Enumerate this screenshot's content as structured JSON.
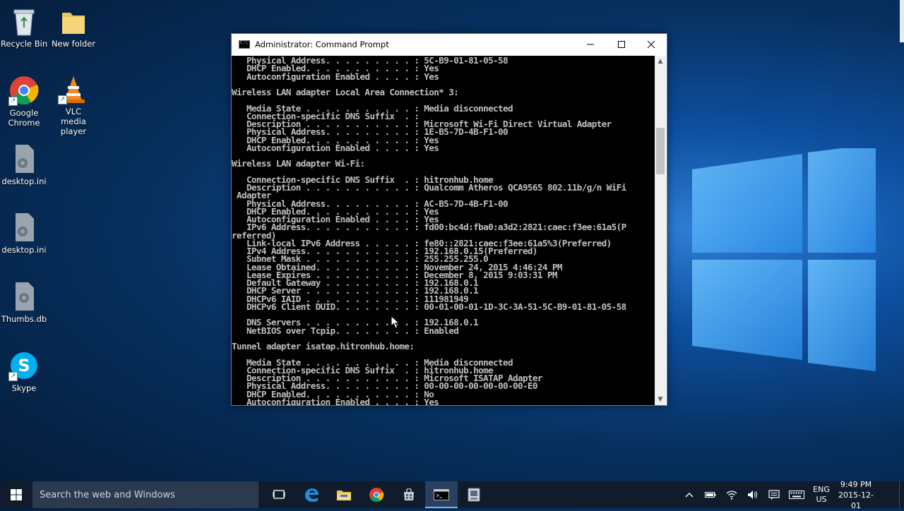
{
  "desktop": {
    "icons": [
      {
        "label": "Recycle Bin",
        "icon": "recycle-bin-icon"
      },
      {
        "label": "New folder",
        "icon": "folder-icon"
      },
      {
        "label": "Google Chrome",
        "icon": "chrome-icon"
      },
      {
        "label": "VLC media player",
        "icon": "vlc-icon"
      },
      {
        "label": "desktop.ini",
        "icon": "settings-file-icon"
      },
      {
        "label": "desktop.ini",
        "icon": "settings-file-icon"
      },
      {
        "label": "Thumbs.db",
        "icon": "settings-file-icon"
      },
      {
        "label": "Skype",
        "icon": "skype-icon"
      }
    ]
  },
  "cmd": {
    "title": "Administrator: Command Prompt",
    "lines": [
      "   Physical Address. . . . . . . . . : 5C-B9-01-81-05-58",
      "   DHCP Enabled. . . . . . . . . . . : Yes",
      "   Autoconfiguration Enabled . . . . : Yes",
      "",
      "Wireless LAN adapter Local Area Connection* 3:",
      "",
      "   Media State . . . . . . . . . . . : Media disconnected",
      "   Connection-specific DNS Suffix  . :",
      "   Description . . . . . . . . . . . : Microsoft Wi-Fi Direct Virtual Adapter",
      "   Physical Address. . . . . . . . . : 1E-B5-7D-4B-F1-00",
      "   DHCP Enabled. . . . . . . . . . . : Yes",
      "   Autoconfiguration Enabled . . . . : Yes",
      "",
      "Wireless LAN adapter Wi-Fi:",
      "",
      "   Connection-specific DNS Suffix  . : hitronhub.home",
      "   Description . . . . . . . . . . . : Qualcomm Atheros QCA9565 802.11b/g/n WiFi",
      " Adapter",
      "   Physical Address. . . . . . . . . : AC-B5-7D-4B-F1-00",
      "   DHCP Enabled. . . . . . . . . . . : Yes",
      "   Autoconfiguration Enabled . . . . : Yes",
      "   IPv6 Address. . . . . . . . . . . : fd00:bc4d:fba0:a3d2:2821:caec:f3ee:61a5(P",
      "referred)",
      "   Link-local IPv6 Address . . . . . : fe80::2821:caec:f3ee:61a5%3(Preferred)",
      "   IPv4 Address. . . . . . . . . . . : 192.168.0.15(Preferred)",
      "   Subnet Mask . . . . . . . . . . . : 255.255.255.0",
      "   Lease Obtained. . . . . . . . . . : November 24, 2015 4:46:24 PM",
      "   Lease Expires . . . . . . . . . . : December 8, 2015 9:03:31 PM",
      "   Default Gateway . . . . . . . . . : 192.168.0.1",
      "   DHCP Server . . . . . . . . . . . : 192.168.0.1",
      "   DHCPv6 IAID . . . . . . . . . . . : 111981949",
      "   DHCPv6 Client DUID. . . . . . . . : 00-01-00-01-1D-3C-3A-51-5C-B9-01-81-05-58",
      "",
      "   DNS Servers . . . . . . . . . . . : 192.168.0.1",
      "   NetBIOS over Tcpip. . . . . . . . : Enabled",
      "",
      "Tunnel adapter isatap.hitronhub.home:",
      "",
      "   Media State . . . . . . . . . . . : Media disconnected",
      "   Connection-specific DNS Suffix  . : hitronhub.home",
      "   Description . . . . . . . . . . . : Microsoft ISATAP Adapter",
      "   Physical Address. . . . . . . . . : 00-00-00-00-00-00-00-E0",
      "   DHCP Enabled. . . . . . . . . . . : No",
      "   Autoconfiguration Enabled . . . . : Yes"
    ]
  },
  "taskbar": {
    "search_placeholder": "Search the web and Windows",
    "apps": [
      "task-view-icon",
      "edge-icon",
      "file-explorer-icon",
      "chrome-icon",
      "store-icon",
      "command-prompt-icon",
      "media-icon"
    ],
    "active_app": "command-prompt-icon",
    "lang_primary": "ENG",
    "lang_secondary": "US",
    "time": "9:49 PM",
    "date": "2015-12-01"
  }
}
